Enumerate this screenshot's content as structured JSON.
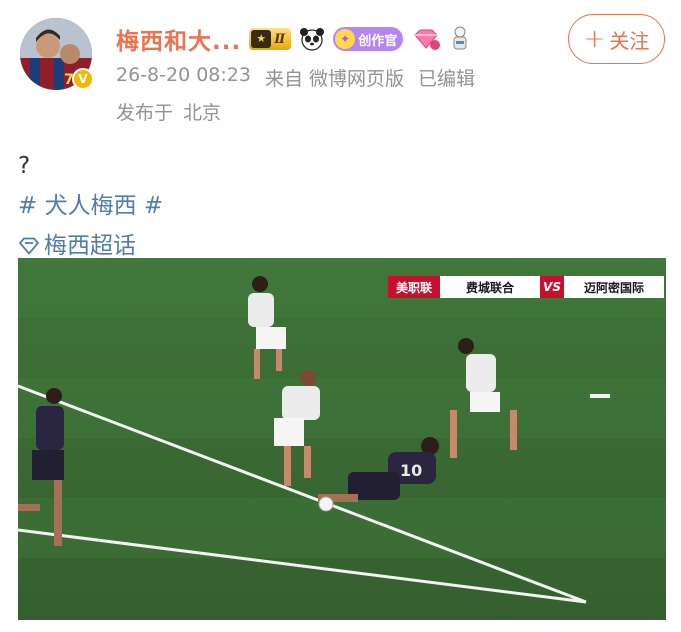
{
  "header": {
    "user_name": "梅西和大...",
    "level_badge": "Ⅱ",
    "creator_badge": "创作官",
    "verified_mark": "V",
    "follow_button": {
      "icon": "plus-icon",
      "label": "关注"
    },
    "timestamp": "26-8-20 08:23",
    "source": "来自 微博网页版",
    "edited": "已编辑",
    "location_prefix": "发布于",
    "location": "北京"
  },
  "content": {
    "text_line": "?",
    "hashtag": "# 犬人梅西 #",
    "super_topic_icon": "diamond-icon",
    "super_topic": "梅西超话"
  },
  "media": {
    "scoreboard": {
      "league": "美职联",
      "home_team": "费城联合",
      "vs": "VS",
      "away_team": "迈阿密国际"
    }
  },
  "colors": {
    "accent": "#eb7350",
    "link": "#507daf",
    "meta": "#939393",
    "pitch": "#3b6a34"
  }
}
